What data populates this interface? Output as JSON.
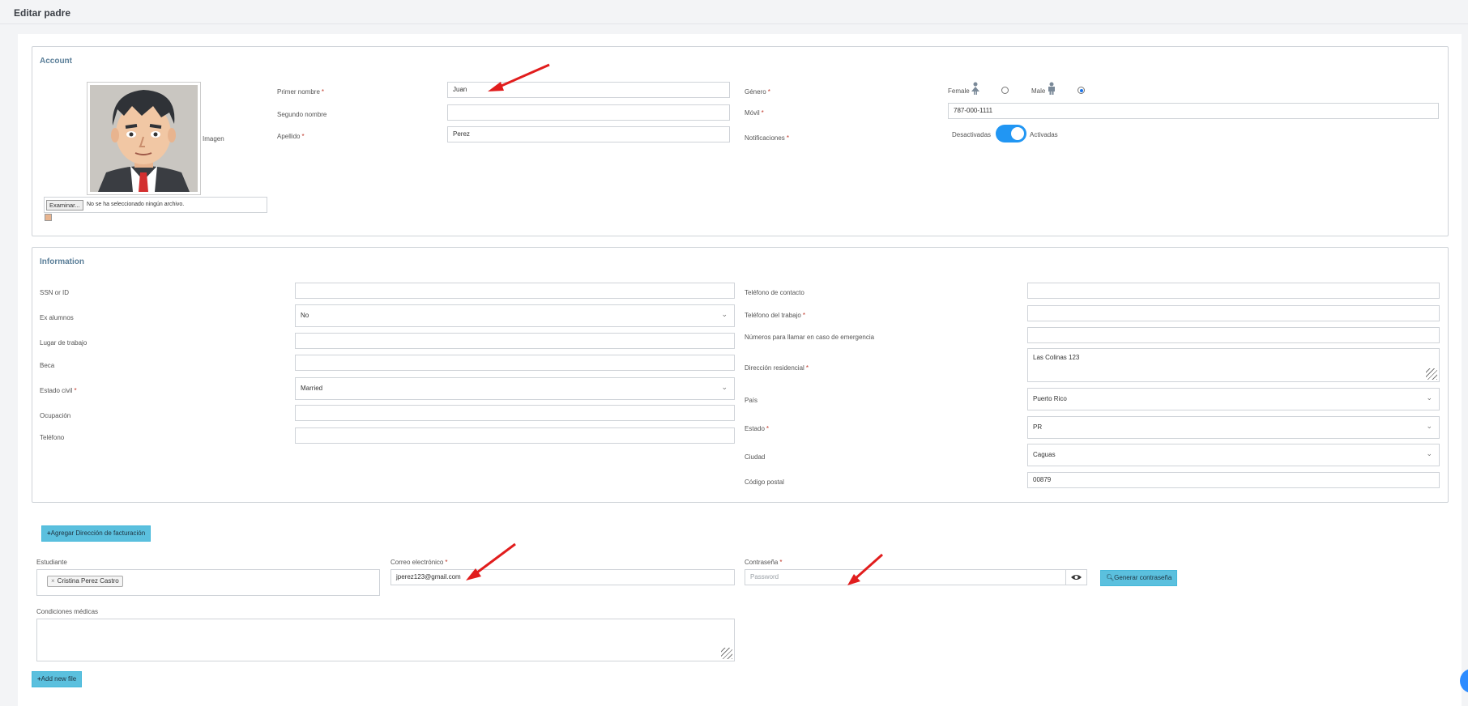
{
  "page_title": "Editar padre",
  "account": {
    "legend": "Account",
    "imagen_label": "Imagen",
    "file_button": "Examinar...",
    "file_status": "No se ha seleccionado ningún archivo.",
    "primer_nombre_label": "Primer nombre",
    "primer_nombre_value": "Juan",
    "segundo_nombre_label": "Segundo nombre",
    "segundo_nombre_value": "",
    "apellido_label": "Apellido",
    "apellido_value": "Perez",
    "genero_label": "Género",
    "female_label": "Female",
    "male_label": "Male",
    "genero_selected": "Male",
    "movil_label": "Móvil",
    "movil_value": "787-000-1111",
    "notificaciones_label": "Notificaciones",
    "notif_off_label": "Desactivadas",
    "notif_on_label": "Activadas",
    "notificaciones_enabled": true
  },
  "information": {
    "legend": "Information",
    "ssn_label": "SSN or ID",
    "ssn_value": "",
    "ex_alumnos_label": "Ex alumnos",
    "ex_alumnos_value": "No",
    "lugar_label": "Lugar de trabajo",
    "lugar_value": "",
    "beca_label": "Beca",
    "beca_value": "",
    "estado_civil_label": "Estado civil",
    "estado_civil_value": "Married",
    "ocupacion_label": "Ocupación",
    "ocupacion_value": "",
    "telefono_label": "Teléfono",
    "telefono_value": "",
    "tel_contacto_label": "Teléfono de contacto",
    "tel_contacto_value": "",
    "tel_trabajo_label": "Teléfono del trabajo",
    "tel_trabajo_value": "",
    "emergencia_label": "Números para llamar en caso de emergencia",
    "emergencia_value": "",
    "direccion_label": "Dirección residencial",
    "direccion_value": "Las Colinas 123",
    "pais_label": "País",
    "pais_value": "Puerto Rico",
    "estado_label": "Estado",
    "estado_value": "PR",
    "ciudad_label": "Ciudad",
    "ciudad_value": "Caguas",
    "postal_label": "Código postal",
    "postal_value": "00879"
  },
  "billing_button": "Agregar Dirección de facturación",
  "estudiante_label": "Estudiante",
  "estudiante_tag": "Cristina Perez Castro",
  "email_label": "Correo electrónico",
  "email_value": "jperez123@gmail.com",
  "password_label": "Contraseña",
  "password_placeholder": "Password",
  "generate_password_button": "Generar contraseña",
  "condiciones_label": "Condiciones médicas",
  "condiciones_value": "",
  "add_file_button": "Add new file",
  "colors": {
    "info_button": "#5bc0de",
    "toggle_on": "#2196f3",
    "annotation_arrow": "#e11d1d",
    "legend": "#5a7e98"
  }
}
